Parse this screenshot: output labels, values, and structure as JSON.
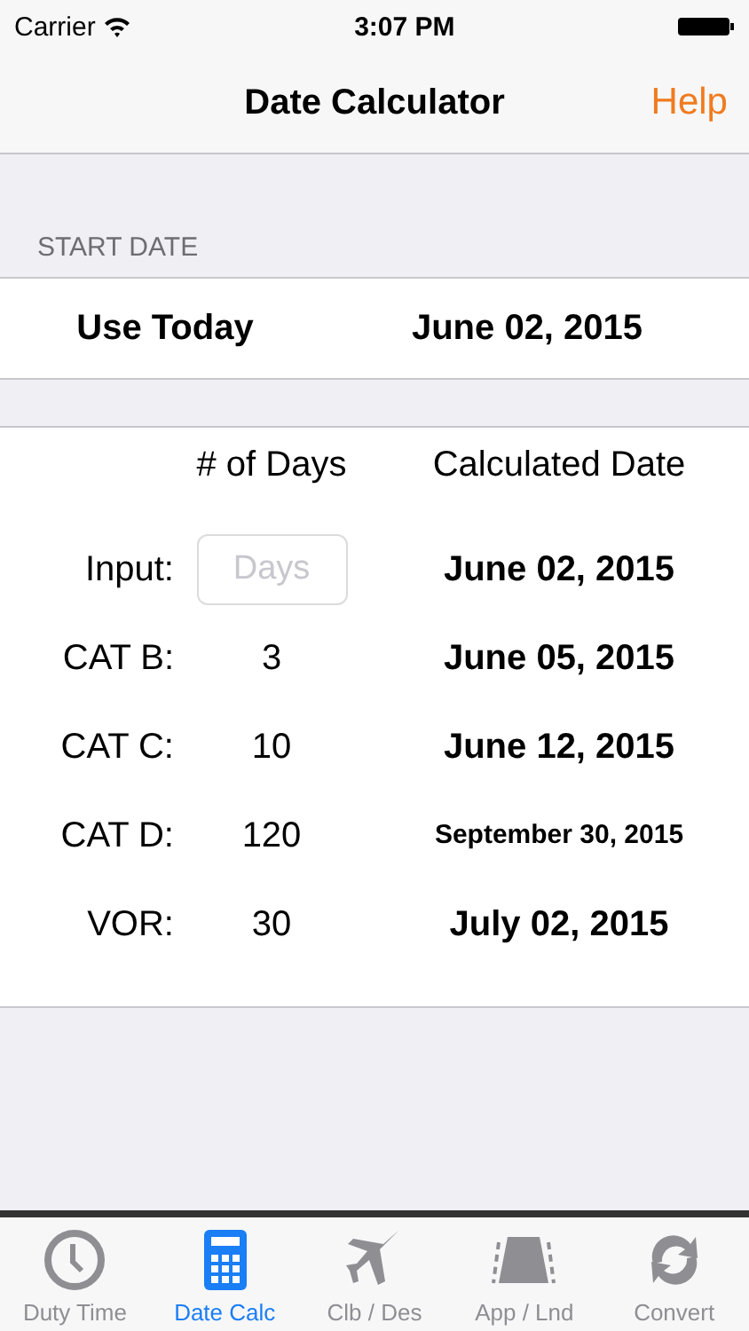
{
  "status_bar": {
    "carrier": "Carrier",
    "time": "3:07 PM"
  },
  "nav": {
    "title": "Date Calculator",
    "action": "Help"
  },
  "start_date": {
    "header": "START DATE",
    "label": "Use Today",
    "value": "June 02, 2015"
  },
  "table": {
    "columns": [
      "# of Days",
      "Calculated Date"
    ],
    "rows": [
      {
        "kind": "input",
        "label": "Input:",
        "placeholder": "Days",
        "date": "June 02, 2015"
      },
      {
        "kind": "text",
        "label": "CAT B:",
        "days": "3",
        "date": "June 05, 2015"
      },
      {
        "kind": "text",
        "label": "CAT C:",
        "days": "10",
        "date": "June 12, 2015"
      },
      {
        "kind": "text",
        "label": "CAT D:",
        "days": "120",
        "date": "September 30, 2015"
      },
      {
        "kind": "text",
        "label": "VOR:",
        "days": "30",
        "date": "July 02, 2015"
      }
    ]
  },
  "tabs": [
    {
      "kind": "clock",
      "label": "Duty Time",
      "selected": false
    },
    {
      "kind": "calculator",
      "label": "Date Calc",
      "selected": true
    },
    {
      "kind": "plane",
      "label": "Clb / Des",
      "selected": false
    },
    {
      "kind": "road",
      "label": "App / Lnd",
      "selected": false
    },
    {
      "kind": "refresh",
      "label": "Convert",
      "selected": false
    }
  ]
}
